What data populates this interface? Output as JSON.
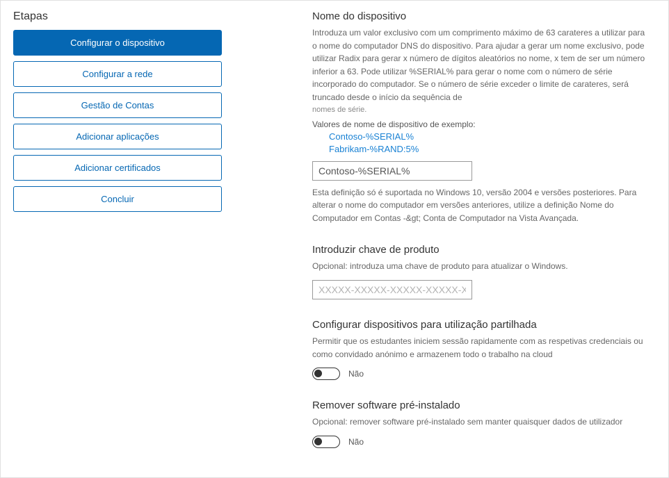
{
  "sidebar": {
    "title": "Etapas",
    "steps": [
      {
        "label": "Configurar o dispositivo",
        "active": true
      },
      {
        "label": "Configurar a rede",
        "active": false
      },
      {
        "label": "Gestão de Contas",
        "active": false
      },
      {
        "label": "Adicionar aplicações",
        "active": false
      },
      {
        "label": "Adicionar certificados",
        "active": false
      },
      {
        "label": "Concluir",
        "active": false
      }
    ]
  },
  "deviceName": {
    "title": "Nome do dispositivo",
    "description": "Introduza um valor exclusivo com um comprimento máximo de 63 carateres a utilizar para o nome do computador DNS do dispositivo. Para ajudar a gerar um nome exclusivo, pode utilizar Radix para gerar x número de dígitos aleatórios no nome, x tem de ser um número inferior a 63. Pode utilizar %SERIAL% para gerar o nome com o número de série incorporado do computador. Se o número de série exceder o limite de carateres, será truncado desde o início da sequência de",
    "serialsLink": "nomes de série.",
    "exampleLabel": "Valores de nome de dispositivo de exemplo:",
    "example1": "Contoso-%SERIAL%",
    "example2": "Fabrikam-%RAND:5%",
    "inputValue": "Contoso-%SERIAL%",
    "note": "Esta definição só é suportada no Windows 10, versão 2004 e versões posteriores. Para alterar o nome do computador em versões anteriores, utilize a definição Nome do Computador em Contas -&gt; Conta de Computador na Vista Avançada."
  },
  "productKey": {
    "title": "Introduzir chave de produto",
    "description": "Opcional: introduza uma chave de produto para atualizar o Windows.",
    "placeholder": "XXXXX-XXXXX-XXXXX-XXXXX-XXXXX"
  },
  "sharedUse": {
    "title": "Configurar dispositivos para utilização partilhada",
    "description": "Permitir que os estudantes iniciem sessão rapidamente com as respetivas credenciais ou como convidado anónimo e armazenem todo o trabalho na cloud",
    "toggleLabel": "Não"
  },
  "removeSoftware": {
    "title": "Remover software pré-instalado",
    "description": "Opcional: remover software pré-instalado sem manter quaisquer dados de utilizador",
    "toggleLabel": "Não"
  }
}
